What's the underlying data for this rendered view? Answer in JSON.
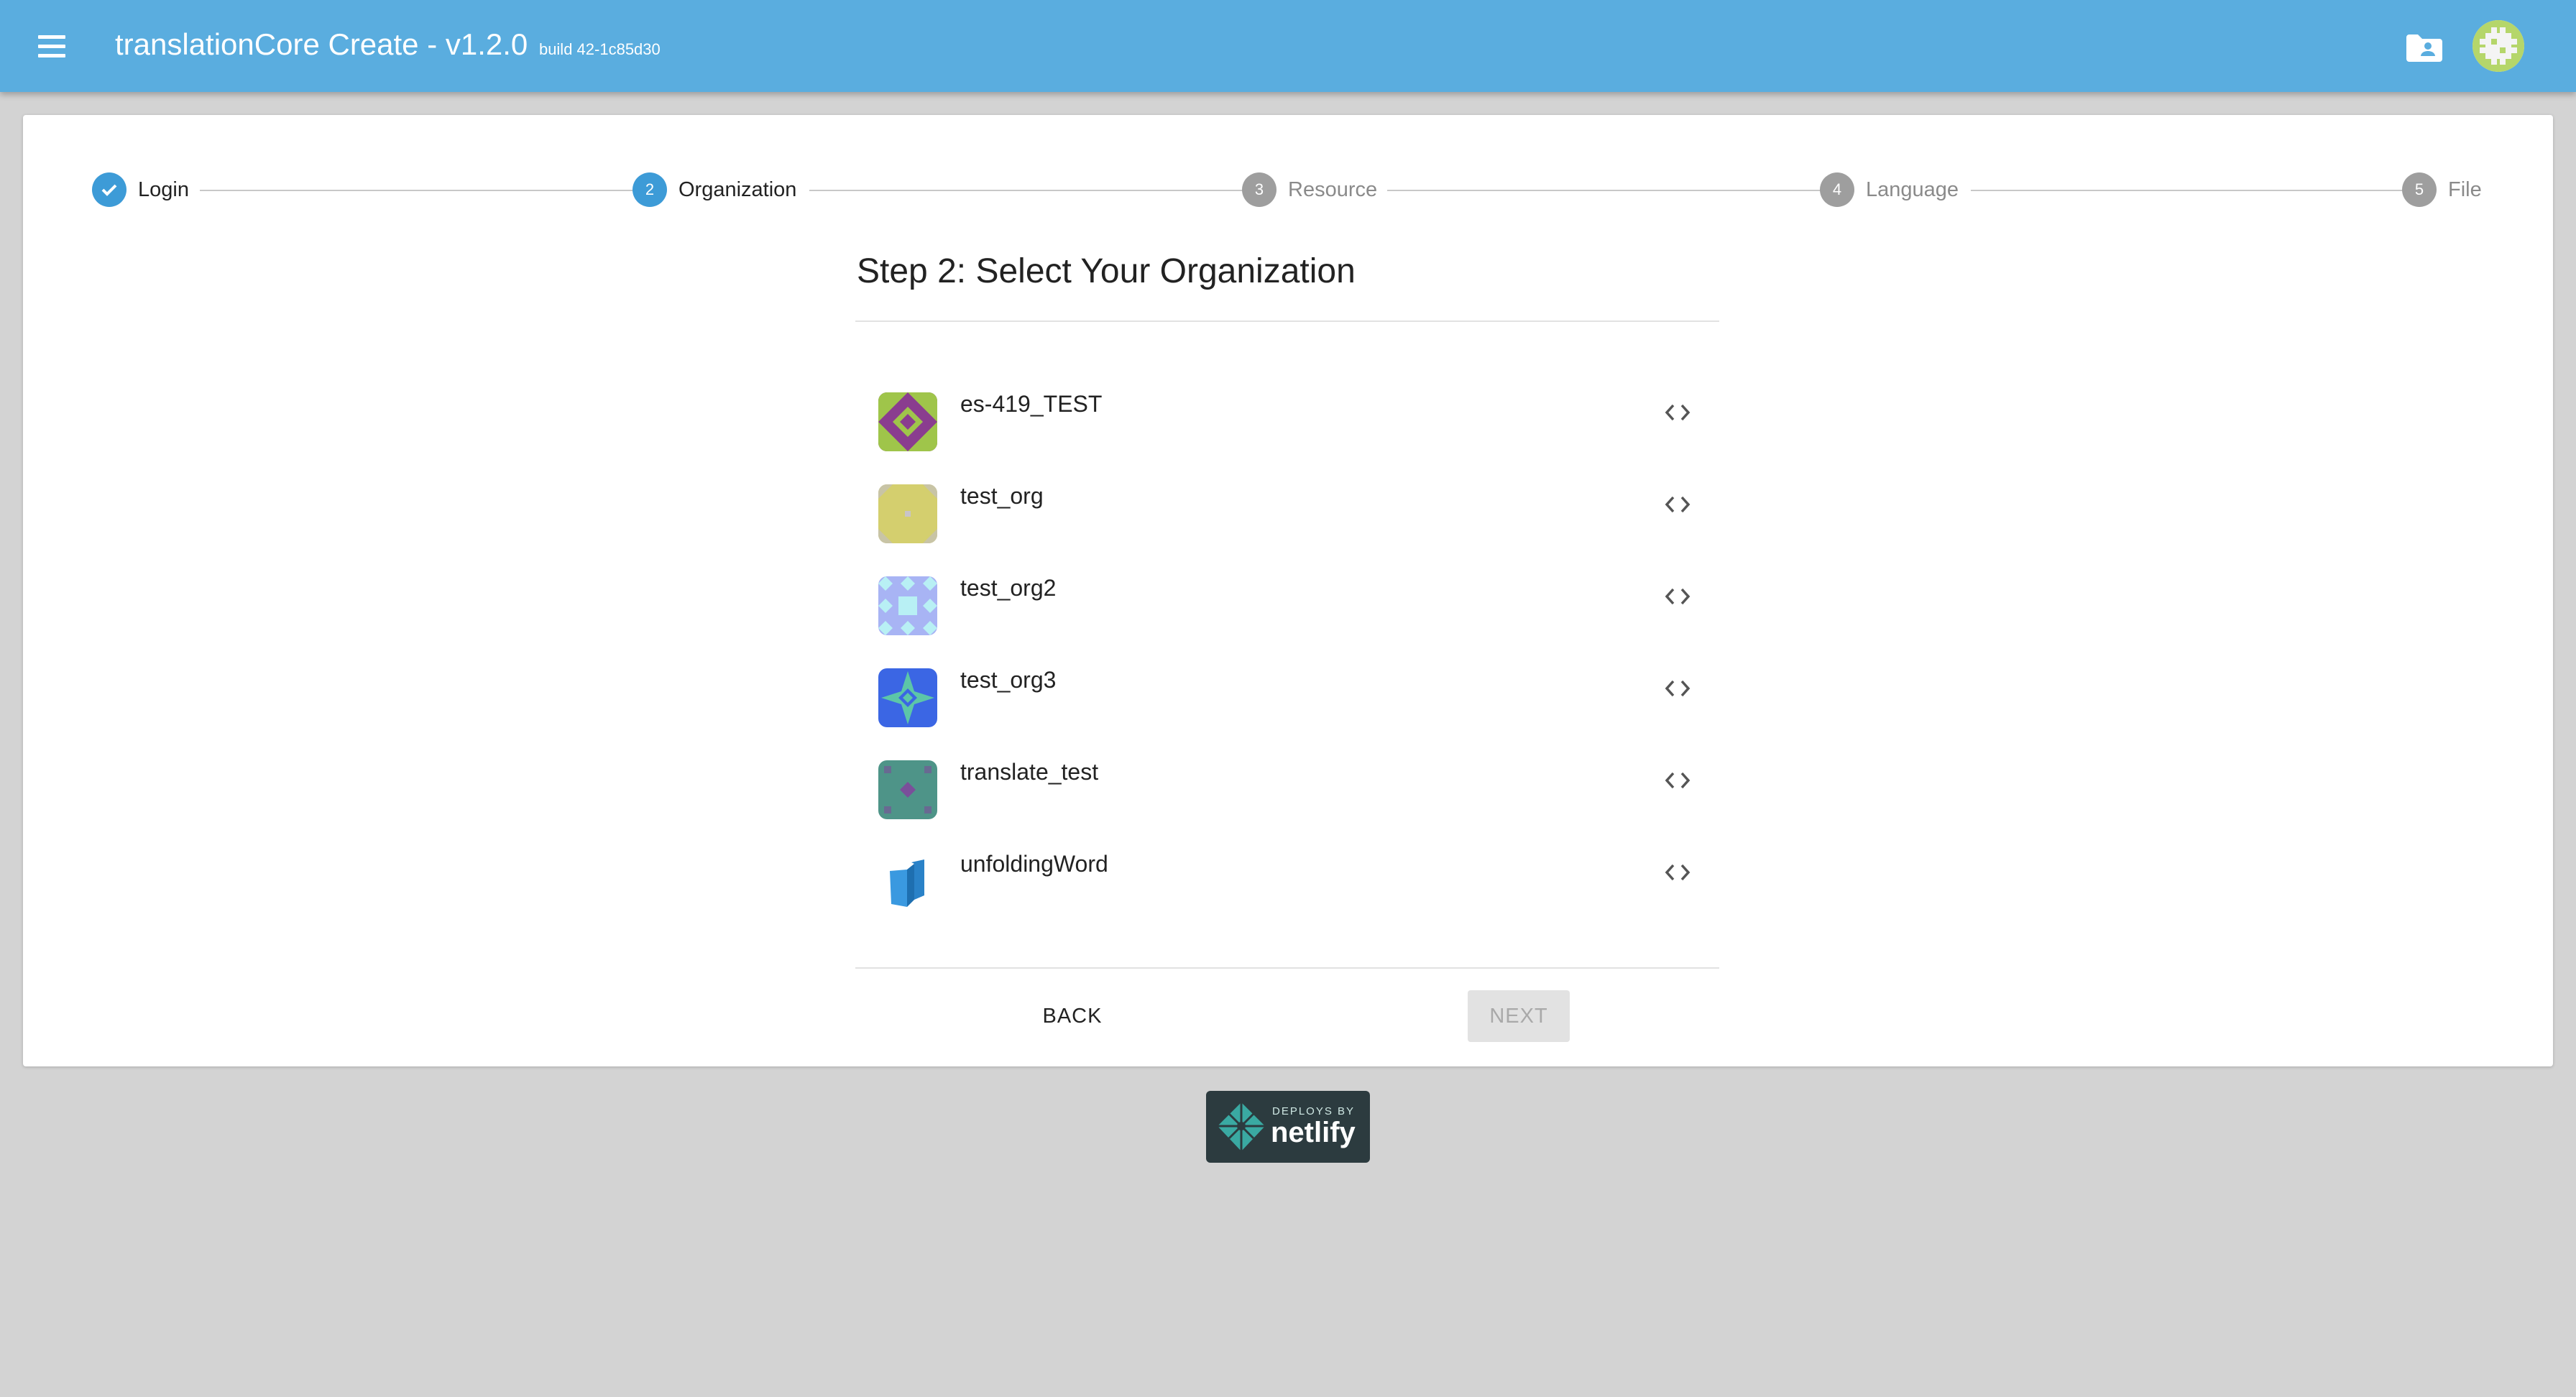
{
  "app_bar": {
    "title": "translationCore Create - v1.2.0",
    "build": "build 42-1c85d30",
    "menu_icon": "hamburger-menu-icon",
    "folder_icon": "folder-account-icon",
    "avatar_icon": "user-identicon",
    "background_color": "#5aaddf"
  },
  "stepper": {
    "steps": [
      {
        "number": "1",
        "label": "Login",
        "state": "completed"
      },
      {
        "number": "2",
        "label": "Organization",
        "state": "active"
      },
      {
        "number": "3",
        "label": "Resource",
        "state": "pending"
      },
      {
        "number": "4",
        "label": "Language",
        "state": "pending"
      },
      {
        "number": "5",
        "label": "File",
        "state": "pending"
      }
    ],
    "active_color": "#3d9bd7",
    "pending_color": "#9e9e9e"
  },
  "main": {
    "title": "Step 2: Select Your Organization",
    "organizations": [
      {
        "name": "es-419_TEST",
        "icon": "org-identicon-green-purple"
      },
      {
        "name": "test_org",
        "icon": "org-identicon-yellow"
      },
      {
        "name": "test_org2",
        "icon": "org-identicon-blue-diamonds"
      },
      {
        "name": "test_org3",
        "icon": "org-identicon-blue-star"
      },
      {
        "name": "translate_test",
        "icon": "org-identicon-teal"
      },
      {
        "name": "unfoldingWord",
        "icon": "unfoldingword-logo"
      }
    ],
    "row_action_icon": "code-brackets-icon",
    "back_label": "BACK",
    "next_label": "NEXT"
  },
  "footer": {
    "badge_small": "DEPLOYS BY",
    "badge_big": "netlify"
  }
}
